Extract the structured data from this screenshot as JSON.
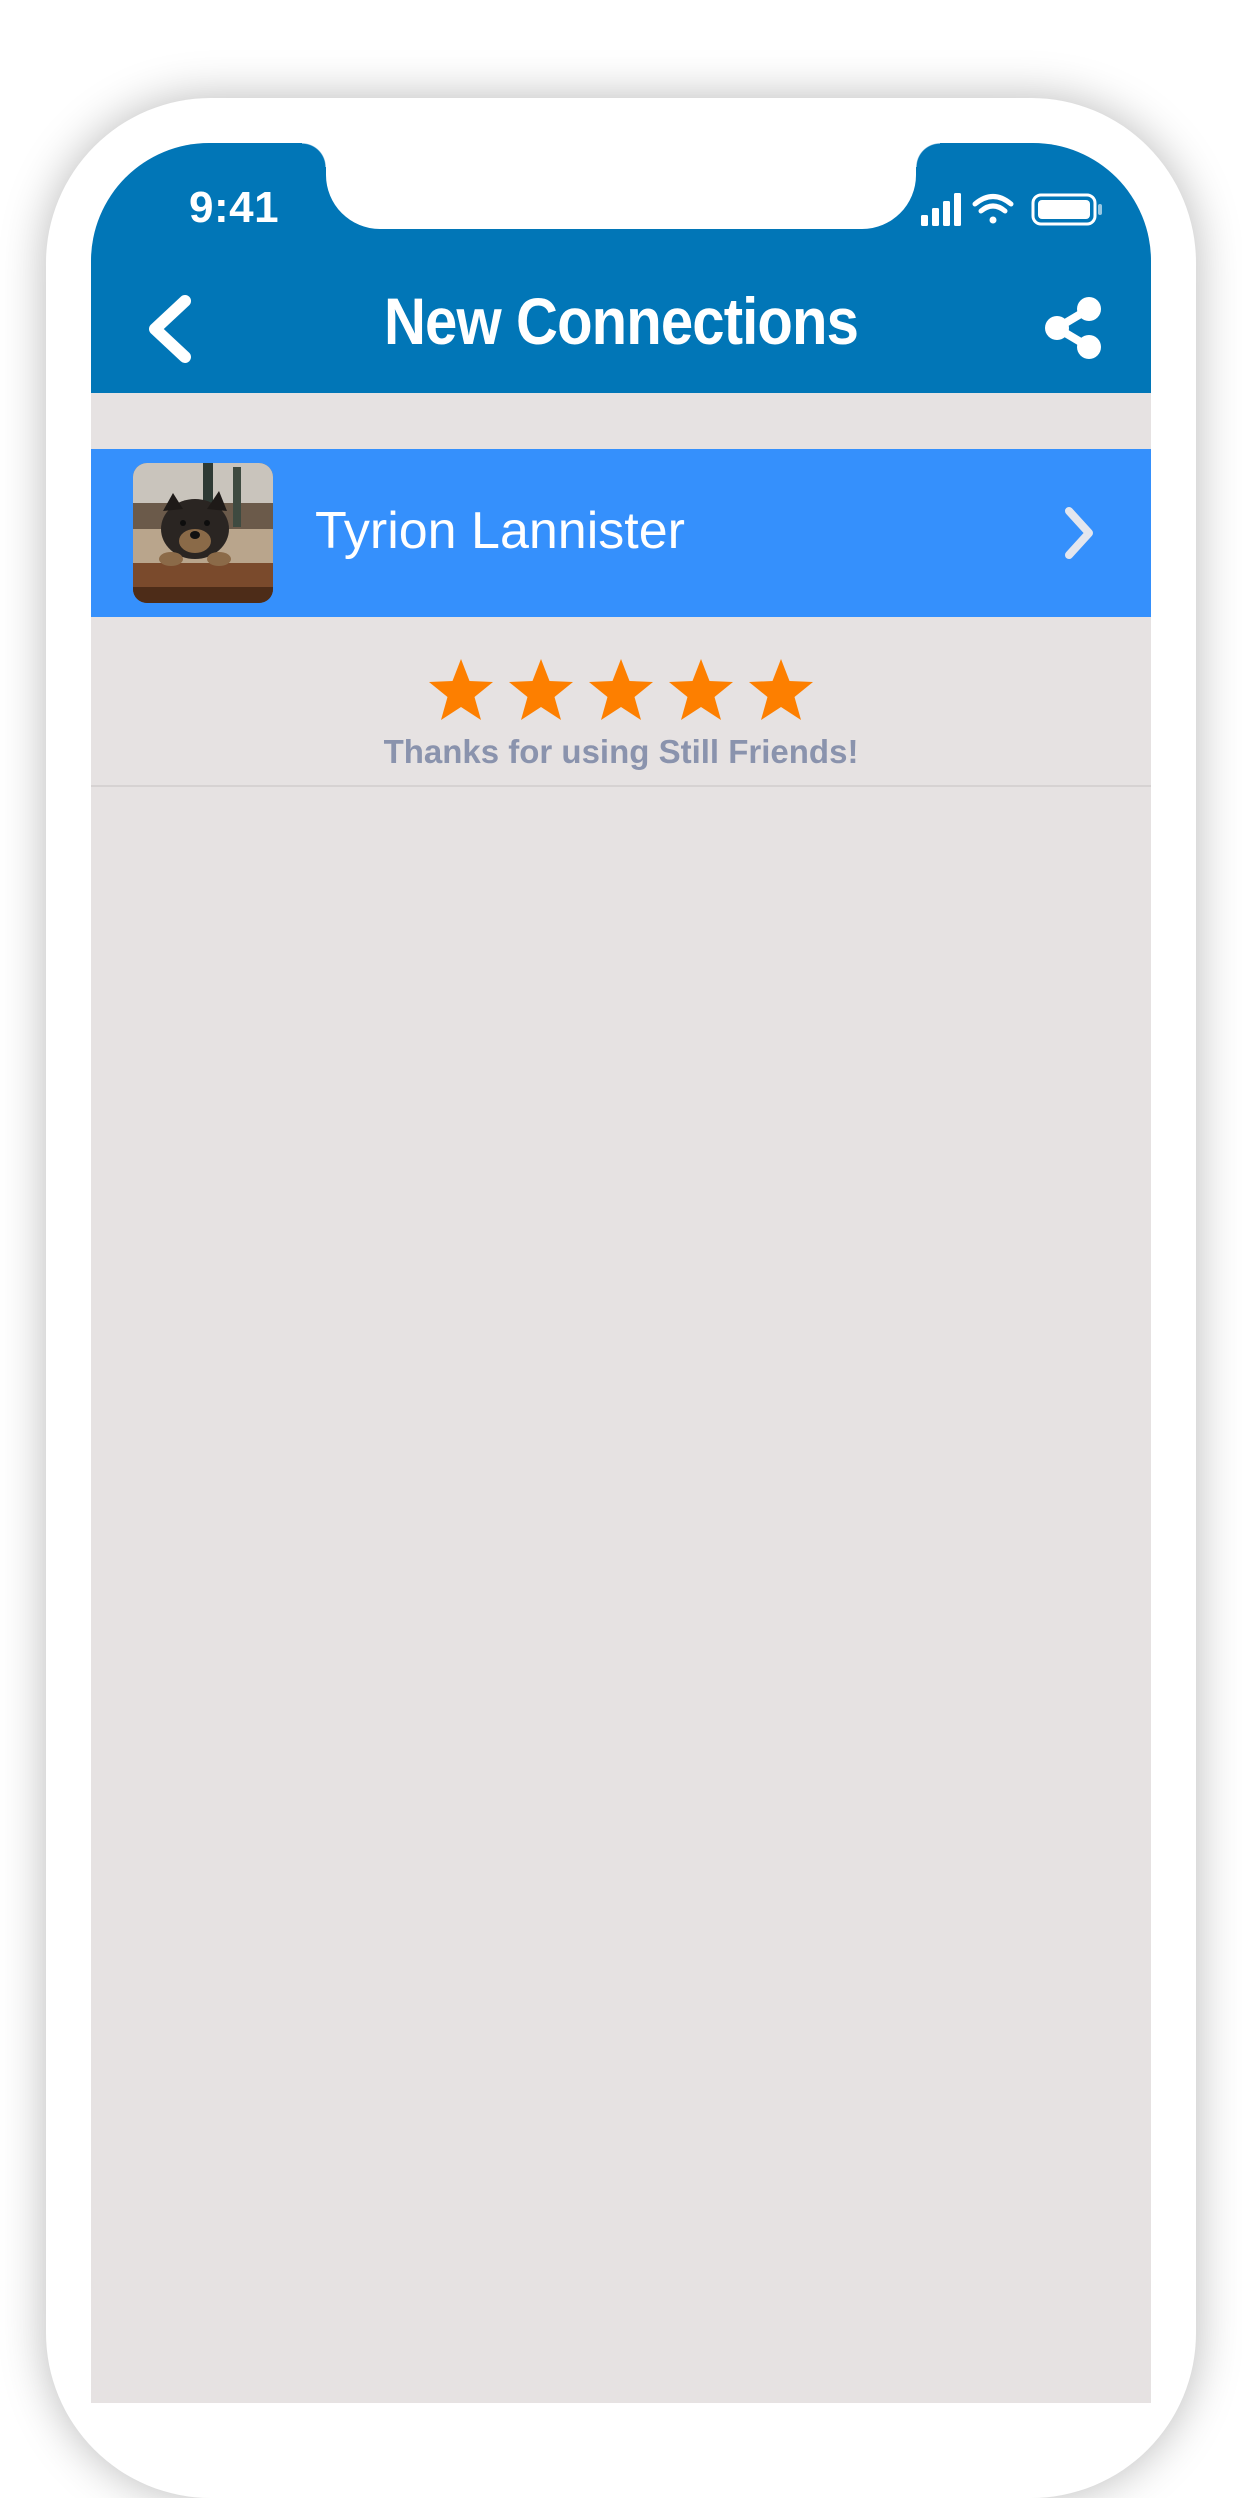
{
  "status_bar": {
    "time": "9:41"
  },
  "nav": {
    "title": "New Connections",
    "back_icon": "chevron-left-icon",
    "share_icon": "share-icon"
  },
  "connections": [
    {
      "name": "Tyrion Lannister",
      "avatar": "dog-photo",
      "chevron_icon": "chevron-right-icon"
    }
  ],
  "rating": {
    "stars": 5,
    "caption": "Thanks for using Still Friends!"
  },
  "colors": {
    "nav_bar": "#0176b7",
    "row_highlight": "#3590fc",
    "background": "#e6e2e2",
    "star": "#fd7f00",
    "caption": "#8a93ad"
  }
}
